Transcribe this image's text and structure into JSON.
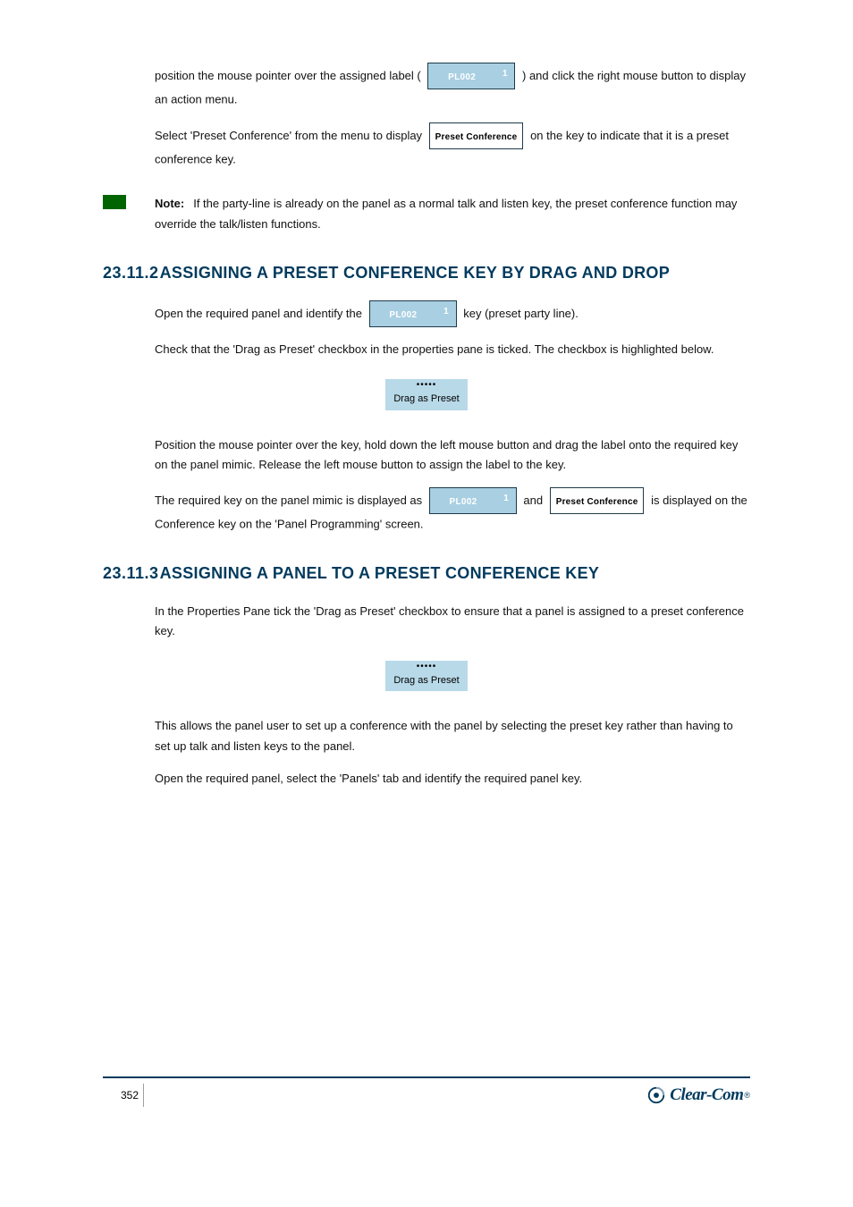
{
  "para1_a": "position the mouse pointer over the assigned label (",
  "para1_b": ") and click the right mouse button to display an action menu.",
  "para2_a": "Select 'Preset Conference' from the menu to display ",
  "para2_b": " on the key to indicate that it is a preset conference key.",
  "note_prefix": "Note:",
  "note_body": "If the party-line is already on the panel as a normal talk and listen key, the preset conference function may override the talk/listen functions.",
  "h_num_1": "23.11.2",
  "h_text_1": "ASSIGNING A PRESET CONFERENCE KEY BY DRAG AND DROP",
  "para3_a": "Open the required panel and identify the ",
  "para3_b": " key (preset party line).",
  "para4": "Check that the 'Drag as Preset' checkbox in the properties pane is ticked. The checkbox is highlighted below.",
  "drag_dots": "•••••",
  "drag_label": "Drag as Preset",
  "para5": "Position the mouse pointer over the key, hold down the left mouse button and drag the label onto the required key on the panel mimic. Release the left mouse button to assign the label to the key.",
  "para6_a": "The required key on the panel mimic is displayed as ",
  "para6_b": " and ",
  "para6_c": " is displayed on the Conference key on the 'Panel Programming' screen.",
  "h_num_2": "23.11.3",
  "h_text_2": "ASSIGNING A PANEL TO A PRESET CONFERENCE KEY",
  "para7": "In the Properties Pane tick the 'Drag as Preset' checkbox to ensure that a panel is assigned to a preset conference key.",
  "para8": "This allows the panel user to set up a conference with the panel by selecting the preset key rather than having to set up talk and listen keys to the panel.",
  "para9": "Open the required panel, select the 'Panels' tab and identify the required panel key.",
  "key_label": "PL002",
  "key_num": "1",
  "preset_conf": "Preset Conference",
  "footer_page": "352",
  "logo_text": "Clear-Com",
  "logo_r": "®"
}
